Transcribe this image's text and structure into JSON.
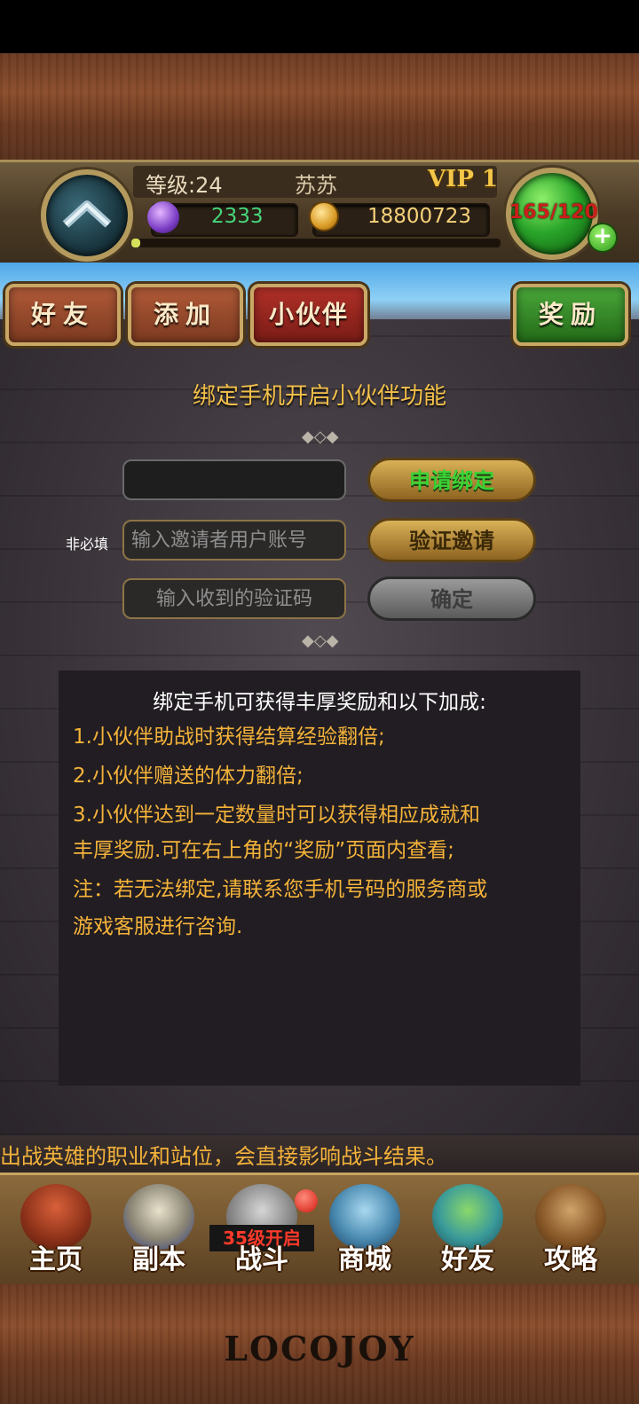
{
  "header": {
    "level": "等级:24",
    "player_name": "苏苏",
    "vip": "VIP 1",
    "gems": "2333",
    "coins": "18800723",
    "energy": "165/120",
    "colors": {
      "gems": "#46d67a",
      "coins": "#f7d27a",
      "name": "#d8c9a8"
    }
  },
  "tabs": [
    {
      "label": "好友",
      "style": "brown"
    },
    {
      "label": "添加",
      "style": "brown"
    },
    {
      "label": "小伙伴",
      "style": "red",
      "active": true
    },
    {
      "label": "奖励",
      "style": "green"
    }
  ],
  "bind": {
    "title": "绑定手机开启小伙伴功能",
    "phone_value": "",
    "apply_button": "申请绑定",
    "optional_label": "非必填",
    "inviter_placeholder": "输入邀请者用户账号",
    "verify_invite_button": "验证邀请",
    "code_placeholder": "输入收到的验证码",
    "confirm_button": "确定"
  },
  "info": {
    "heading": "绑定手机可获得丰厚奖励和以下加成:",
    "lines": [
      "1.小伙伴助战时获得结算经验翻倍;",
      "2.小伙伴赠送的体力翻倍;",
      "3.小伙伴达到一定数量时可以获得相应成就和",
      "丰厚奖励.可在右上角的“奖励”页面内查看;",
      "注：若无法绑定,请联系您手机号码的服务商或",
      "游戏客服进行咨询."
    ]
  },
  "ticker": "出战英雄的职业和站位，会直接影响战斗结果。",
  "nav": [
    {
      "label": "主页",
      "icon": "house-icon"
    },
    {
      "label": "副本",
      "icon": "skull-icon"
    },
    {
      "label": "战斗",
      "icon": "crossed-swords-icon",
      "locked_text": "35级开启"
    },
    {
      "label": "商城",
      "icon": "monster-shop-icon"
    },
    {
      "label": "好友",
      "icon": "friends-icon"
    },
    {
      "label": "攻略",
      "icon": "book-icon"
    }
  ],
  "logo": "LOCOJOY"
}
